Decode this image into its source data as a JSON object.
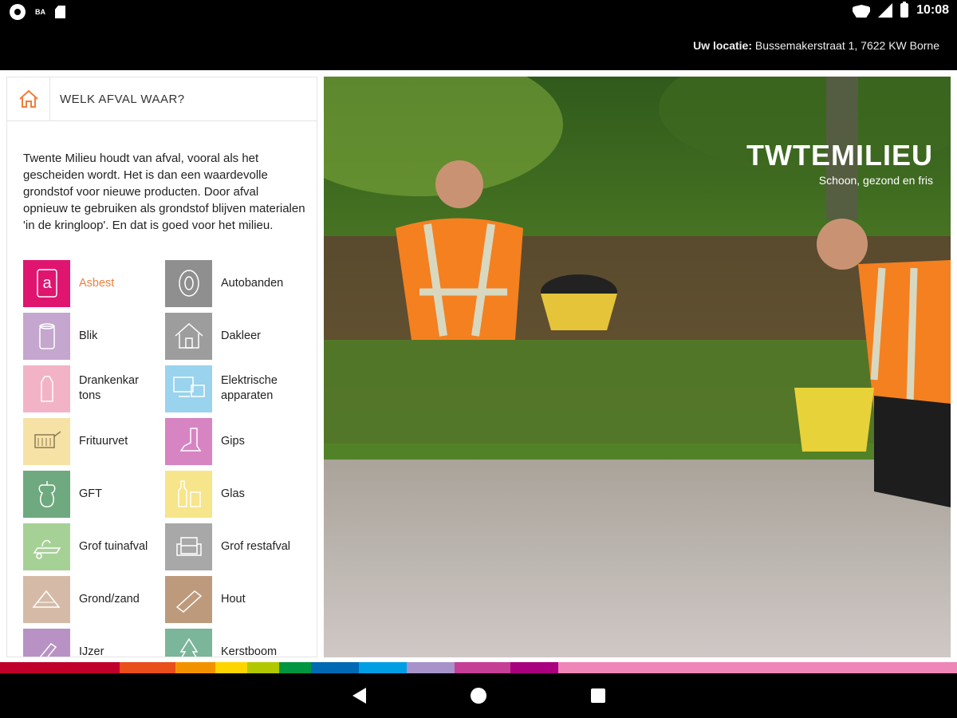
{
  "statusbar": {
    "time": "10:08",
    "left_icons": [
      "notification-circle-icon",
      "ba-icon",
      "sd-card-icon"
    ],
    "right_icons": [
      "wifi-icon",
      "signal-icon",
      "battery-icon"
    ],
    "ba_label": "BA"
  },
  "header": {
    "location_label": "Uw locatie:",
    "location_value": " Bussemakerstraat 1, 7622 KW Borne"
  },
  "panel": {
    "title": "WELK AFVAL WAAR?",
    "intro": "Twente Milieu houdt van afval, vooral als het gescheiden wordt. Het is dan een waardevolle grondstof voor nieuwe producten. Door afval opnieuw te gebruiken als grondstof blijven materialen 'in de kringloop'. En dat is goed voor het milieu."
  },
  "categories": [
    {
      "label": "Asbest",
      "color": "#e0156f",
      "icon": "asbestos-icon",
      "active": true
    },
    {
      "label": "Autobanden",
      "color": "#8f8f8f",
      "icon": "tire-icon",
      "active": false
    },
    {
      "label": "Blik",
      "color": "#c4a6cf",
      "icon": "can-icon",
      "active": false
    },
    {
      "label": "Dakleer",
      "color": "#9d9d9d",
      "icon": "roof-icon",
      "active": false
    },
    {
      "label": "Drankenkar tons",
      "color": "#f3b3c6",
      "icon": "carton-icon",
      "active": false
    },
    {
      "label": "Elektrische apparaten",
      "color": "#9ad3ed",
      "icon": "electronics-icon",
      "active": false
    },
    {
      "label": "Frituurvet",
      "color": "#f7e2a6",
      "icon": "fryer-icon",
      "active": false
    },
    {
      "label": "Gips",
      "color": "#d784c3",
      "icon": "plaster-icon",
      "active": false
    },
    {
      "label": "GFT",
      "color": "#6fa97f",
      "icon": "apple-core-icon",
      "active": false
    },
    {
      "label": "Glas",
      "color": "#f6e58b",
      "icon": "glass-icon",
      "active": false
    },
    {
      "label": "Grof tuinafval",
      "color": "#a6d196",
      "icon": "garden-waste-icon",
      "active": false
    },
    {
      "label": "Grof restafval",
      "color": "#a8a8a8",
      "icon": "armchair-icon",
      "active": false
    },
    {
      "label": "Grond/zand",
      "color": "#d5bba7",
      "icon": "sand-icon",
      "active": false
    },
    {
      "label": "Hout",
      "color": "#be9a7c",
      "icon": "wood-icon",
      "active": false
    },
    {
      "label": "IJzer",
      "color": "#b892c4",
      "icon": "iron-icon",
      "active": false
    },
    {
      "label": "Kerstboom",
      "color": "#7bb59a",
      "icon": "christmas-tree-icon",
      "active": false
    }
  ],
  "brand": {
    "logo_text": "TWTEMILIEU",
    "tagline": "Schoon, gezond en fris"
  },
  "colors": {
    "accent": "#f07f3c",
    "stripe": [
      "#c0002a",
      "#e94e1b",
      "#f39200",
      "#ffd500",
      "#b1c800",
      "#00963f",
      "#0069b4",
      "#009fe3",
      "#a792c9",
      "#c63f96",
      "#a8007e",
      "#ee86b7"
    ]
  },
  "navbar": {
    "icons": [
      "back-icon",
      "home-icon",
      "recent-apps-icon"
    ]
  }
}
